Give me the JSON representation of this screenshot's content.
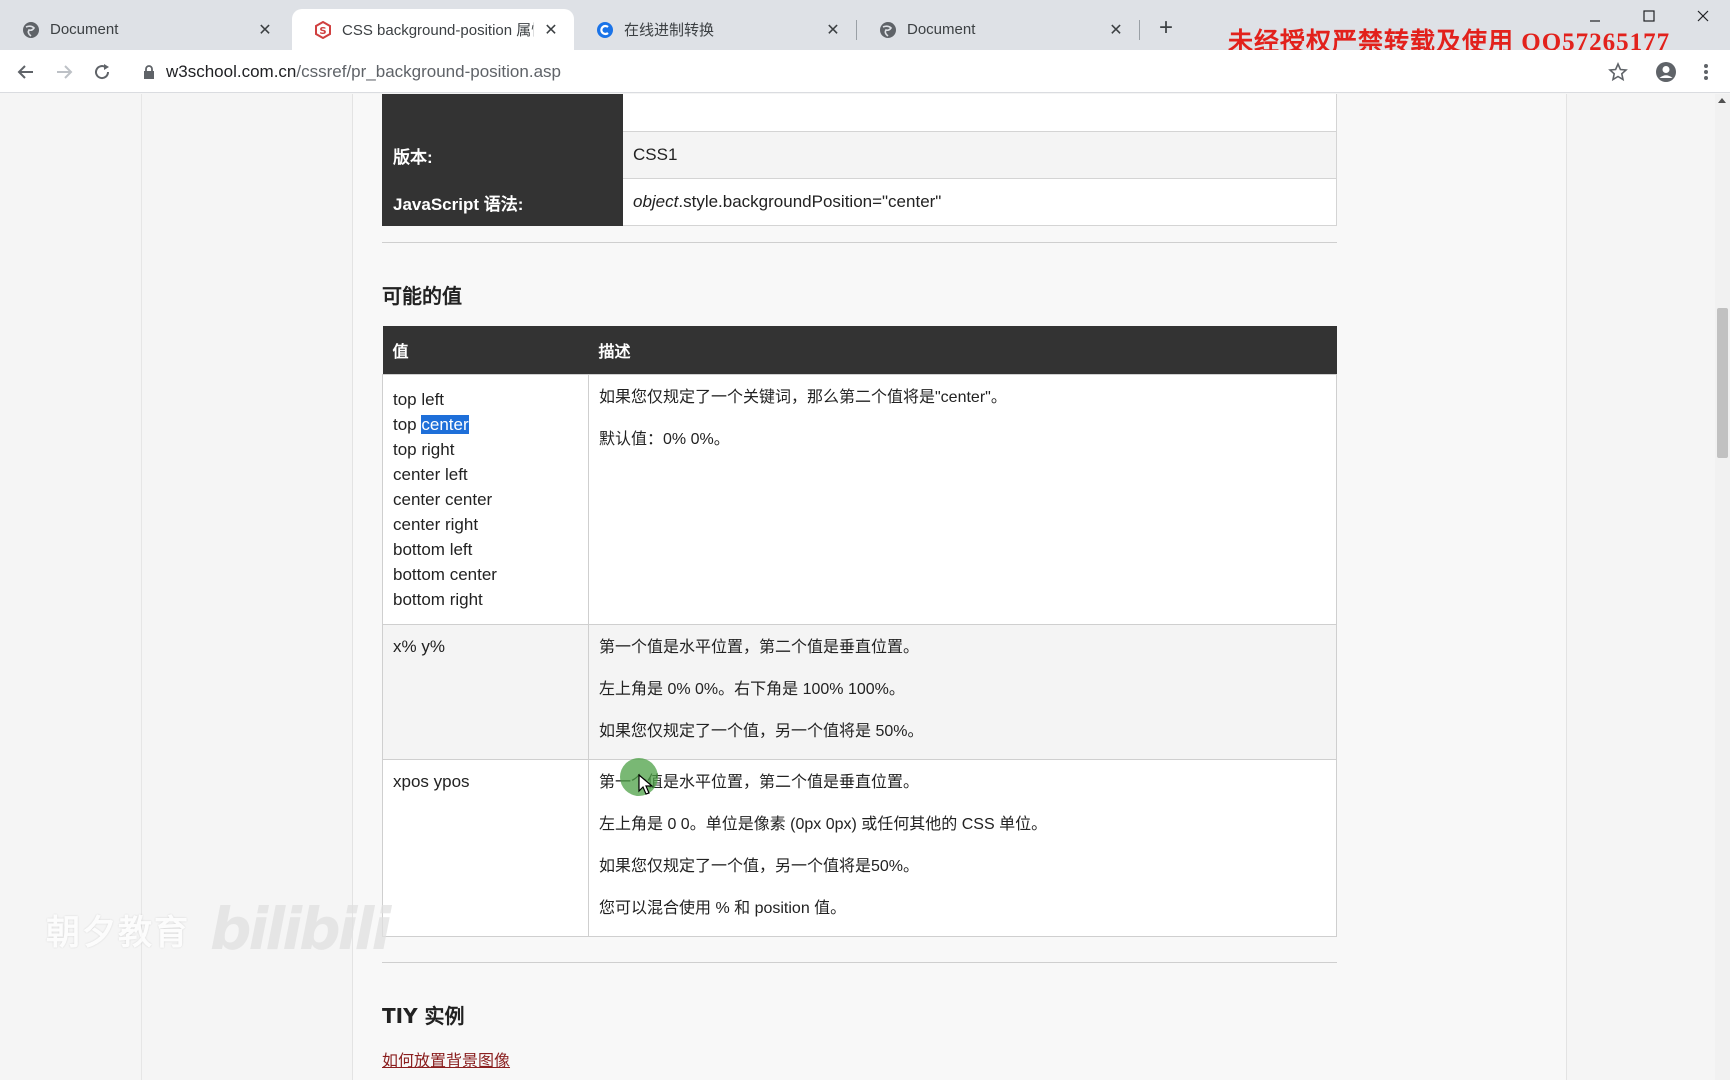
{
  "browser": {
    "tabs": [
      {
        "title": "Document",
        "favicon": "globe-icon",
        "active": false
      },
      {
        "title": "CSS background-position 属性",
        "favicon": "w3school-icon",
        "active": true
      },
      {
        "title": "在线进制转换",
        "favicon": "c-logo-icon",
        "active": false
      },
      {
        "title": "Document",
        "favicon": "globe-icon",
        "active": false
      }
    ],
    "watermark": "未经授权严禁转载及使用 QQ57265177",
    "url_host": "w3school.com.cn",
    "url_path": "/cssref/pr_background-position.asp"
  },
  "top_table": {
    "rows": [
      {
        "key": "版本:",
        "value": "CSS1"
      },
      {
        "key": "JavaScript 语法:",
        "value_obj": "object",
        "value_rest": ".style.backgroundPosition=\"center\""
      }
    ]
  },
  "section_values": {
    "heading": "可能的值",
    "header_value": "值",
    "header_desc": "描述",
    "rows": [
      {
        "keywords": [
          "top left",
          "top",
          "center",
          "top right",
          "center left",
          "center center",
          "center right",
          "bottom left",
          "bottom center",
          "bottom right"
        ],
        "desc": [
          "如果您仅规定了一个关键词，那么第二个值将是\"center\"。",
          "默认值：0% 0%。"
        ]
      },
      {
        "value": "x% y%",
        "desc": [
          "第一个值是水平位置，第二个值是垂直位置。",
          "左上角是 0% 0%。右下角是 100% 100%。",
          "如果您仅规定了一个值，另一个值将是 50%。"
        ]
      },
      {
        "value": "xpos ypos",
        "desc": [
          "第一个值是水平位置，第二个值是垂直位置。",
          "左上角是 0 0。单位是像素 (0px 0px) 或任何其他的 CSS 单位。",
          "如果您仅规定了一个值，另一个值将是50%。",
          "您可以混合使用 % 和 position 值。"
        ]
      }
    ]
  },
  "section_tiy": {
    "heading": "TIY 实例",
    "link": "如何放置背景图像"
  },
  "overlay": {
    "brand": "朝夕教育",
    "logo": "bilibili"
  },
  "colors": {
    "header_bg": "#333333",
    "selection": "#1e6fd9",
    "watermark": "#e2211c",
    "link": "#8a1e1e"
  }
}
